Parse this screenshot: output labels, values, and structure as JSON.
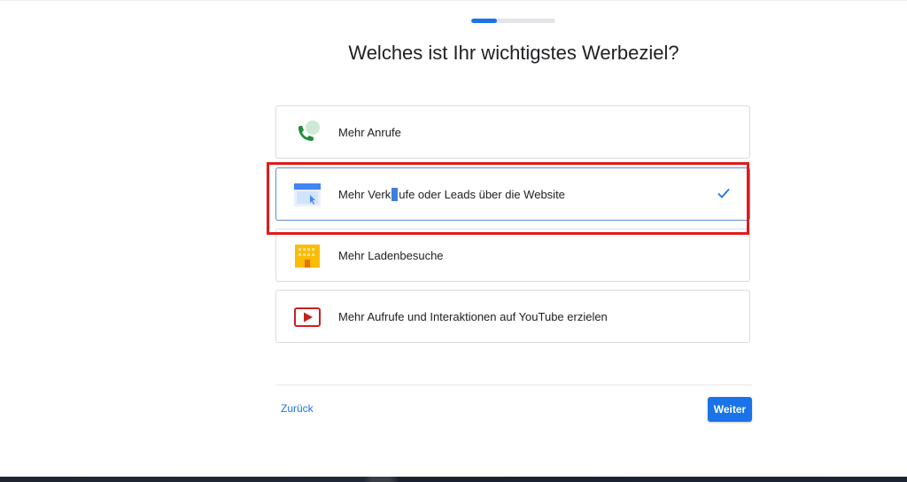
{
  "wizard": {
    "progress_fraction": 0.3,
    "title": "Welches ist Ihr wichtigstes Werbeziel?"
  },
  "options": [
    {
      "label": "Mehr Anrufe",
      "icon": "phone-icon",
      "selected": false
    },
    {
      "label_before": "Mehr Verk",
      "label_cursor_char": "ä",
      "label_after": "ufe oder Leads über die Website",
      "icon": "website-icon",
      "selected": true
    },
    {
      "label": "Mehr Ladenbesuche",
      "icon": "store-icon",
      "selected": false
    },
    {
      "label": "Mehr Aufrufe und Interaktionen auf YouTube erzielen",
      "icon": "youtube-play-icon",
      "selected": false
    }
  ],
  "footer": {
    "back_label": "Zurück",
    "next_label": "Weiter"
  },
  "colors": {
    "accent": "#1a73e8",
    "highlight": "#e01b1b",
    "text": "#202124"
  }
}
